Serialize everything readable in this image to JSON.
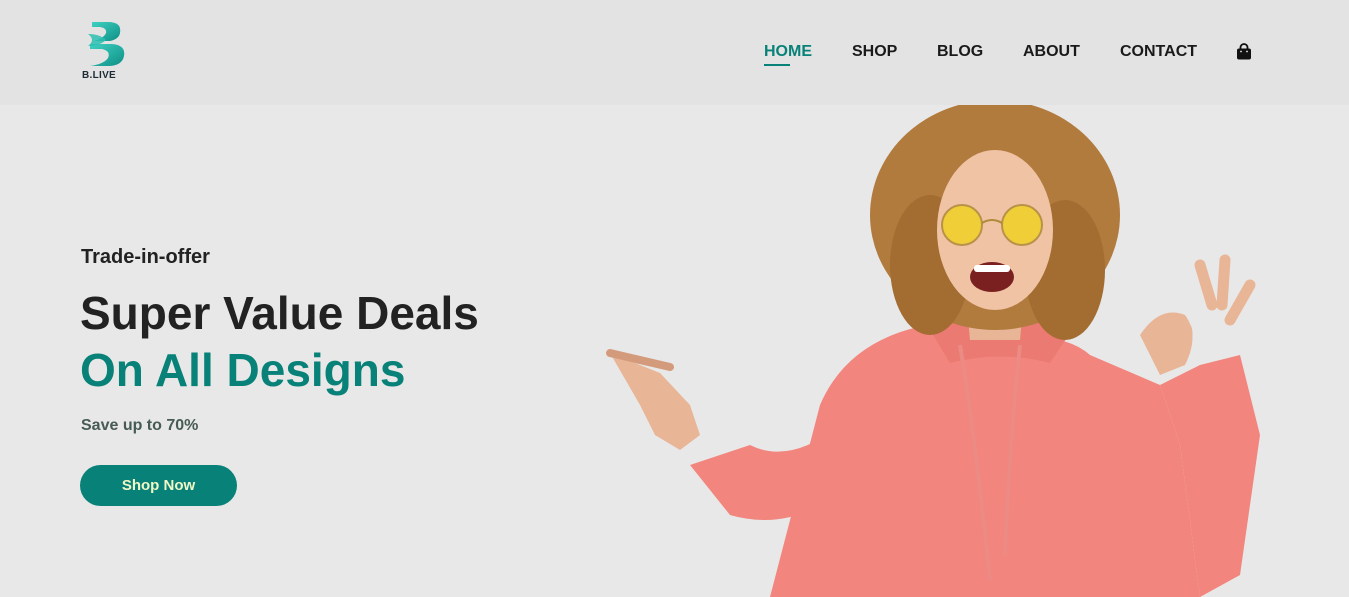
{
  "brand": {
    "logo_text": "B.LIVE",
    "accent": "#088178"
  },
  "nav": {
    "items": [
      {
        "label": "HOME",
        "active": true
      },
      {
        "label": "SHOP",
        "active": false
      },
      {
        "label": "BLOG",
        "active": false
      },
      {
        "label": "ABOUT",
        "active": false
      },
      {
        "label": "CONTACT",
        "active": false
      }
    ],
    "cart_icon": "shopping-bag-icon"
  },
  "hero": {
    "tagline": "Trade-in-offer",
    "headline_1": "Super Value Deals",
    "headline_2": "On All Designs",
    "subtext": "Save up to 70%",
    "cta_label": "Shop Now",
    "image": "model-image"
  }
}
